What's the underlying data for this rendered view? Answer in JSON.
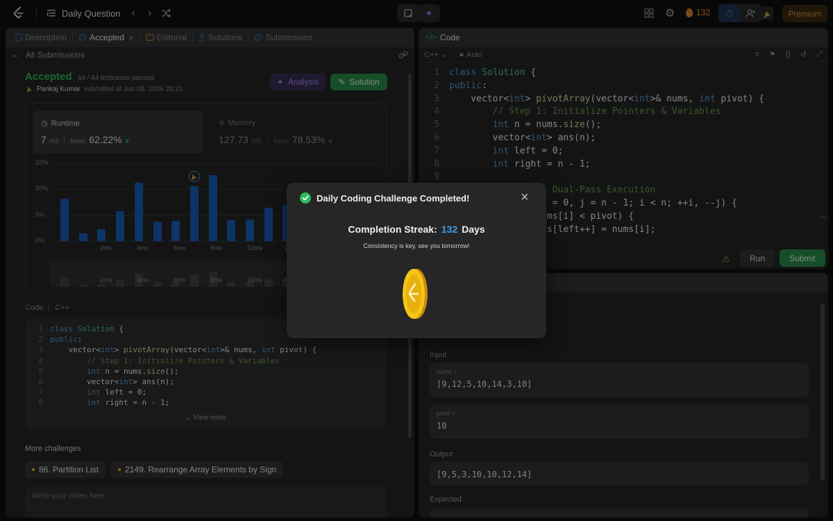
{
  "topbar": {
    "title": "Daily Question",
    "streak_count": "132",
    "premium_label": "Premium"
  },
  "left": {
    "tabs": [
      {
        "label": "Description"
      },
      {
        "label": "Accepted"
      },
      {
        "label": "Editorial"
      },
      {
        "label": "Solutions"
      },
      {
        "label": "Submissions"
      }
    ],
    "back_label": "All Submissions",
    "status": "Accepted",
    "testcases": "44 / 44 testcases passed",
    "user": "Pankaj Kumar",
    "submitted": "submitted at Jun 08, 2026 20:21",
    "analysis_label": "Analysis",
    "solution_label": "Solution",
    "runtime": {
      "label": "Runtime",
      "value": "7",
      "unit": "ms",
      "beats_label": "Beats",
      "beats": "62.22%"
    },
    "memory": {
      "label": "Memory",
      "value": "127.73",
      "unit": "MB",
      "beats_label": "Beats",
      "beats": "78.53%"
    },
    "code_header": "Code",
    "code_lang": "C++",
    "view_more": "View more",
    "more_challenges": "More challenges",
    "challenges": [
      "86. Partition List",
      "2149. Rearrange Array Elements by Sign"
    ],
    "notes_placeholder": "Write your notes here"
  },
  "chart_data": {
    "type": "bar",
    "y_ticks": [
      "15%",
      "10%",
      "5%",
      "0%"
    ],
    "x_ticks": [
      "2ms",
      "4ms",
      "6ms",
      "8ms",
      "10ms",
      "12ms"
    ],
    "ylim": [
      0,
      15
    ],
    "values": [
      8.2,
      1.5,
      2.3,
      5.8,
      11.3,
      3.8,
      3.9,
      10.6,
      12.7,
      4.0,
      4.1,
      6.4,
      7.0
    ],
    "highlight_index": 7,
    "color": "#1a5db8"
  },
  "left_code": [
    "class Solution {",
    "public:",
    "    vector<int> pivotArray(vector<int>& nums, int pivot) {",
    "        // Step 1: Initialize Pointers & Variables",
    "        int n = nums.size();",
    "        vector<int> ans(n);",
    "        int left = 0;",
    "        int right = n - 1;"
  ],
  "editor": {
    "title": "Code",
    "lang": "C++",
    "mode": "Auto",
    "run_label": "Run",
    "submit_label": "Submit",
    "lines": [
      "class Solution {",
      "public:",
      "    vector<int> pivotArray(vector<int>& nums, int pivot) {",
      "        // Step 1: Initialize Pointers & Variables",
      "        int n = nums.size();",
      "        vector<int> ans(n);",
      "        int left = 0;",
      "        int right = n - 1;",
      "",
      "        // Step 2: Dual-Pass Execution",
      "        for (int i = 0, j = n - 1; i < n; ++i, --j) {",
      "            if (nums[i] < pivot) {",
      "                ans[left++] = nums[i];"
    ]
  },
  "testcase": {
    "input_label": "Input",
    "nums_label": "nums =",
    "nums_value": "[9,12,5,10,14,3,10]",
    "pivot_label": "pivot =",
    "pivot_value": "10",
    "output_label": "Output",
    "output_value": "[9,5,3,10,10,12,14]",
    "expected_label": "Expected"
  },
  "modal": {
    "title": "Daily Coding Challenge Completed!",
    "streak_label": "Completion Streak:",
    "streak_value": "132",
    "streak_unit": "Days",
    "message": "Consistency is key, see you tomorrow!"
  },
  "colors": {
    "accent_green": "#2cbb5d",
    "accent_blue": "#3b9be8",
    "streak_orange": "#ffa116"
  }
}
